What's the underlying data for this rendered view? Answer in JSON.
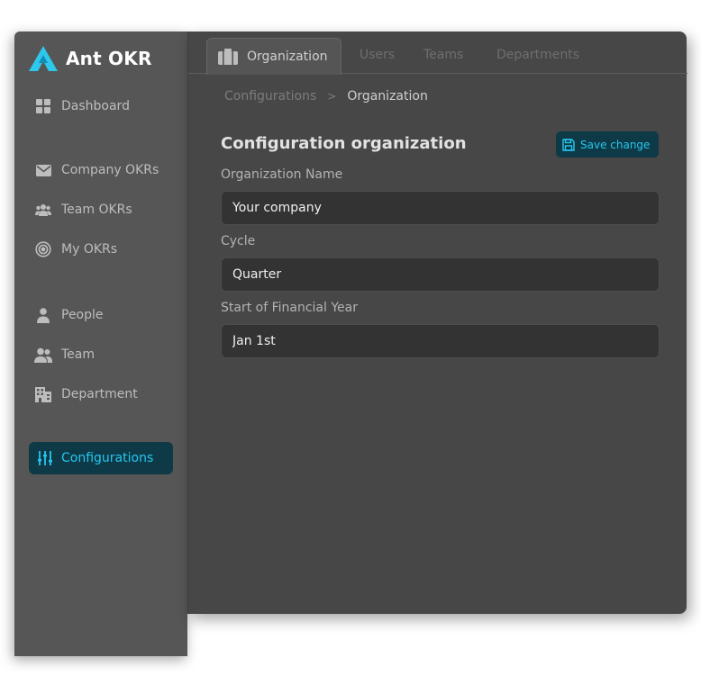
{
  "app": {
    "name": "Ant OKR"
  },
  "sidebar": {
    "items": [
      {
        "label": "Dashboard",
        "icon": "grid-icon"
      },
      {
        "label": "Company OKRs",
        "icon": "envelope-icon"
      },
      {
        "label": "Team OKRs",
        "icon": "group-icon"
      },
      {
        "label": "My OKRs",
        "icon": "target-icon"
      },
      {
        "label": "People",
        "icon": "person-icon"
      },
      {
        "label": "Team",
        "icon": "users-icon"
      },
      {
        "label": "Department",
        "icon": "building-icon"
      },
      {
        "label": "Configurations",
        "icon": "sliders-icon",
        "active": true
      }
    ]
  },
  "tabs": [
    {
      "label": "Organization",
      "active": true,
      "icon": "briefcase-icon"
    },
    {
      "label": "Users"
    },
    {
      "label": "Teams"
    },
    {
      "label": "Departments"
    }
  ],
  "breadcrumb": {
    "parent": "Configurations",
    "separator": ">",
    "current": "Organization"
  },
  "form": {
    "title": "Configuration organization",
    "save_label": "Save change",
    "fields": [
      {
        "label": "Organization Name",
        "value": "Your company"
      },
      {
        "label": "Cycle",
        "value": "Quarter"
      },
      {
        "label": "Start of Financial Year",
        "value": "Jan 1st"
      }
    ]
  },
  "colors": {
    "accent": "#27c5ee",
    "accent_bg": "#0e3a48",
    "sidebar_bg": "#565656",
    "main_bg": "#474747",
    "input_bg": "#333333"
  }
}
